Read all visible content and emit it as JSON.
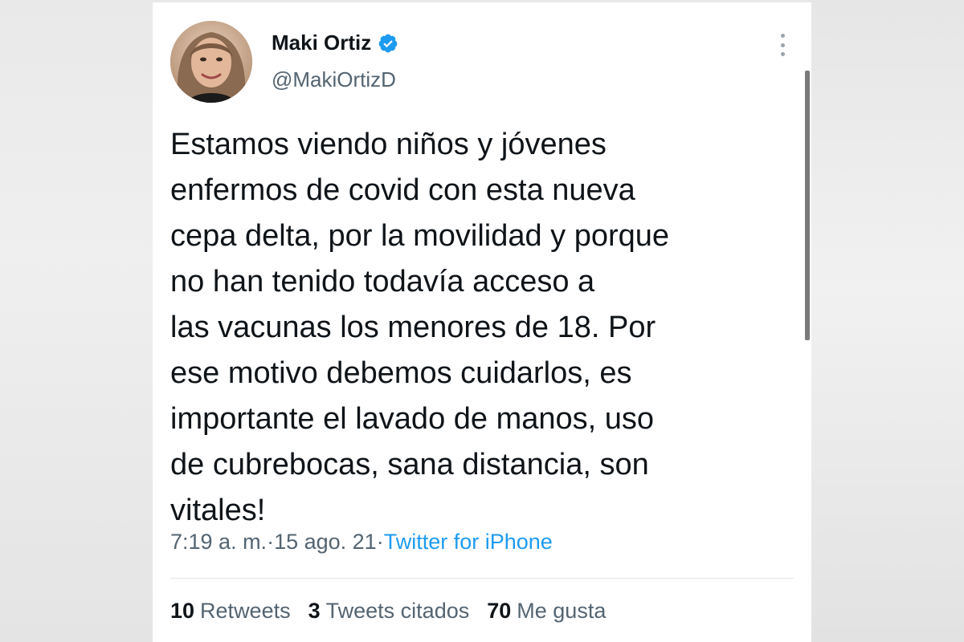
{
  "tweet": {
    "author": {
      "display_name": "Maki Ortiz",
      "handle": "@MakiOrtizD",
      "verified": true,
      "verified_color": "#1d9bf0"
    },
    "text": "Estamos viendo niños y jóvenes\nenfermos de covid con esta nueva\ncepa delta, por la movilidad y porque\nno han tenido todavía acceso a\nlas vacunas los menores de 18. Por\nese motivo debemos cuidarlos, es\nimportante el lavado de manos, uso\nde cubrebocas, sana distancia, son\nvitales!",
    "time": "7:19 a. m.",
    "separator": " · ",
    "date": "15 ago. 21",
    "source": "Twitter for iPhone",
    "stats": {
      "retweets_count": "10",
      "retweets_label": "Retweets",
      "quotes_count": "3",
      "quotes_label": "Tweets citados",
      "likes_count": "70",
      "likes_label": "Me gusta"
    }
  },
  "icons": {
    "verified": "verified-badge-icon",
    "more": "more-vertical-icon"
  },
  "colors": {
    "text_primary": "#0f1419",
    "text_secondary": "#536471",
    "link": "#1d9bf0"
  }
}
